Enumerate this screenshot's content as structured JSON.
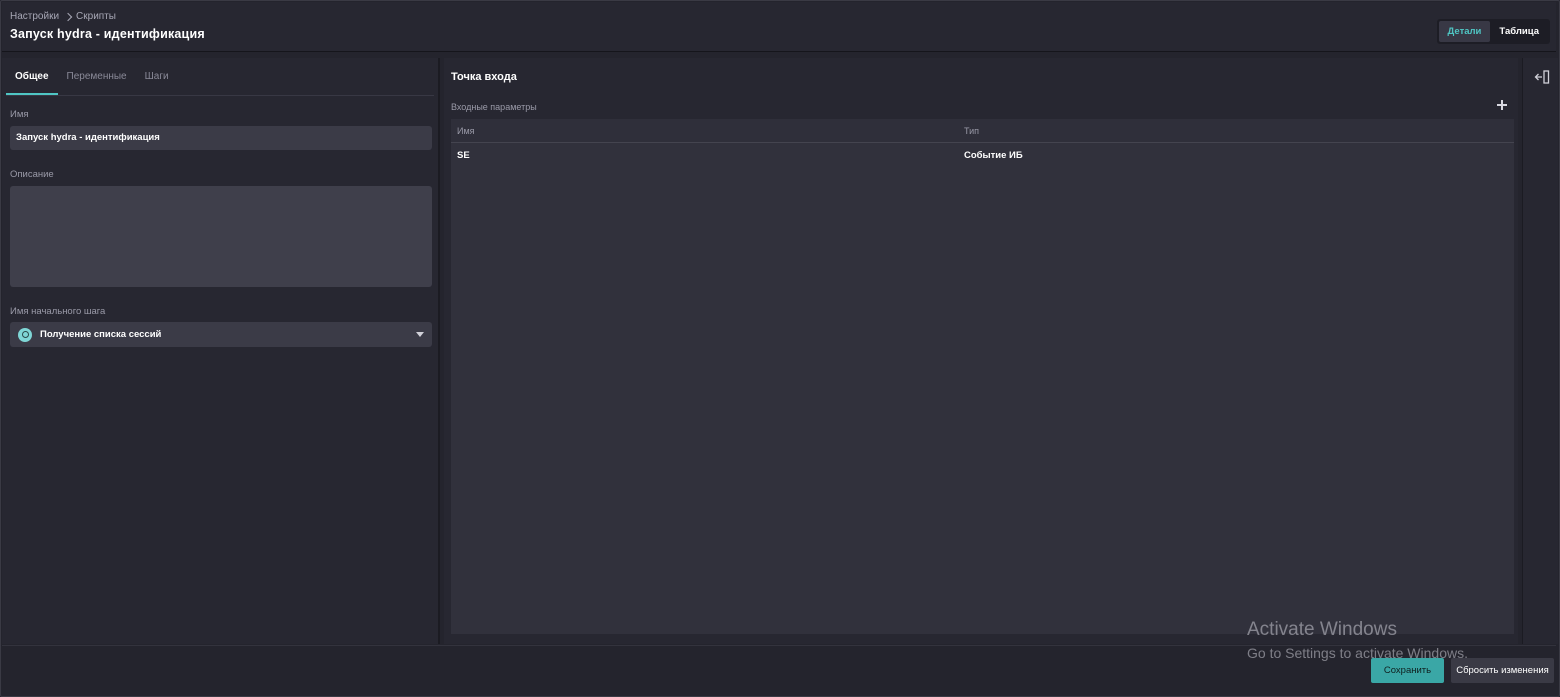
{
  "breadcrumb": {
    "root": "Настройки",
    "current": "Скрипты"
  },
  "page_title": "Запуск hydra - идентификация",
  "view_toggle": {
    "details": "Детали",
    "table": "Таблица"
  },
  "left": {
    "tabs": [
      "Общее",
      "Переменные",
      "Шаги"
    ],
    "name_label": "Имя",
    "name_value": "Запуск hydra - идентификация",
    "description_label": "Описание",
    "description_value": "",
    "start_step_label": "Имя начального шага",
    "start_step_value": "Получение списка сессий"
  },
  "main": {
    "title": "Точка входа",
    "params_label": "Входные параметры",
    "table": {
      "headers": [
        "Имя",
        "Тип"
      ],
      "rows": [
        [
          "SE",
          "Событие ИБ"
        ]
      ]
    }
  },
  "footer": {
    "save": "Сохранить",
    "reset": "Сбросить изменения"
  },
  "watermark": {
    "line1": "Activate Windows",
    "line2": "Go to Settings to activate Windows."
  },
  "colors": {
    "accent": "#4fc6c4",
    "save_button": "#3aa7a6",
    "background": "#272731"
  },
  "icons": {
    "add": "plus-icon",
    "collapse": "collapse-panel-icon",
    "step": "step-icon",
    "dropdown": "chevron-down-icon"
  }
}
